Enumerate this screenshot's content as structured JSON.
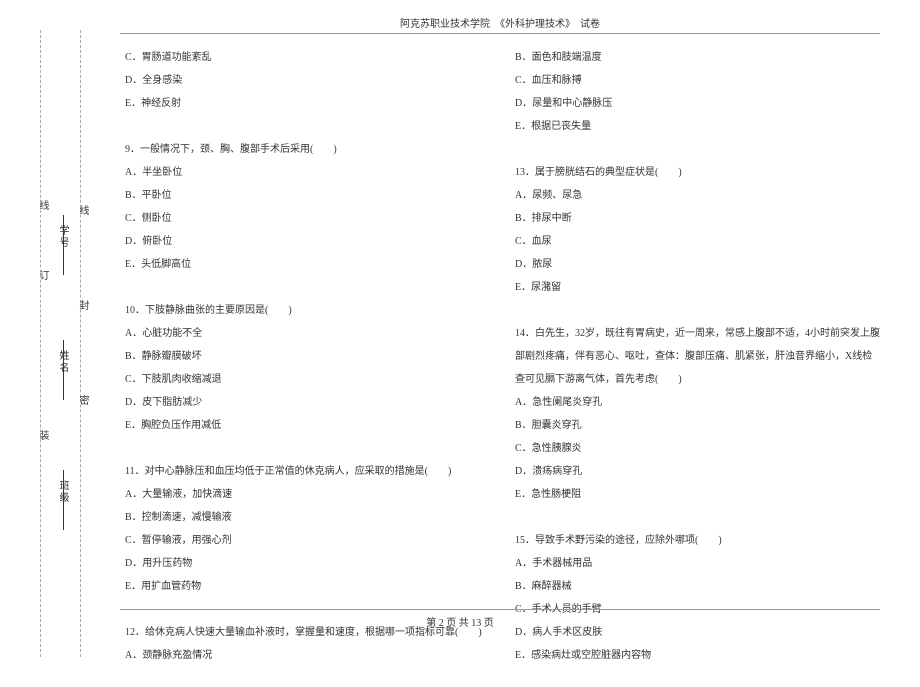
{
  "header": {
    "title": "阿克苏职业技术学院　《外科护理技术》　试卷"
  },
  "binding": {
    "class_label": "班级",
    "name_label": "姓名",
    "id_label": "学号",
    "mi": "密",
    "feng": "封",
    "xian_inner": "线",
    "zhuang": "装",
    "ding": "订",
    "xian_outer": "线"
  },
  "left_column": {
    "items": [
      "C．胃肠道功能紊乱",
      "D．全身感染",
      "E．神经反射",
      "",
      "9．一般情况下，颈、胸、腹部手术后采用(　　)",
      "A．半坐卧位",
      "B．平卧位",
      "C．侧卧位",
      "D．俯卧位",
      "E．头低脚高位",
      "",
      "10．下肢静脉曲张的主要原因是(　　)",
      "A．心脏功能不全",
      "B．静脉瓣膜破坏",
      "C．下肢肌肉收缩减退",
      "D．皮下脂肪减少",
      "E．胸腔负压作用减低",
      "",
      "11．对中心静脉压和血压均低于正常值的休克病人，应采取的措施是(　　)",
      "A．大量输液，加快滴速",
      "B．控制滴速，减慢输液",
      "C．暂停输液，用强心剂",
      "D．用升压药物",
      "E．用扩血管药物",
      "",
      "12．给休克病人快速大量输血补液时，掌握量和速度，根据哪一项指标可靠(　　)",
      "A．颈静脉充盈情况"
    ]
  },
  "right_column": {
    "items": [
      "B．面色和肢端温度",
      "C．血压和脉搏",
      "D．尿量和中心静脉压",
      "E．根据已丧失量",
      "",
      "13．属于膀胱结石的典型症状是(　　)",
      "A．尿频、尿急",
      "B．排尿中断",
      "C．血尿",
      "D．脓尿",
      "E．尿潴留",
      "",
      "14．白先生，32岁，既往有胃病史，近一周来，常感上腹部不适，4小时前突发上腹部剧烈疼痛，伴有恶心、呕吐，查体：腹部压痛、肌紧张，肝浊音界缩小，X线检查可见膈下游离气体，首先考虑(　　)",
      "A．急性阑尾炎穿孔",
      "B．胆囊炎穿孔",
      "C．急性胰腺炎",
      "D．溃疡病穿孔",
      "E．急性肠梗阻",
      "",
      "15．导致手术野污染的途径，应除外哪项(　　)",
      "A．手术器械用品",
      "B．麻醉器械",
      "C．手术人员的手臂",
      "D．病人手术区皮肤",
      "E．感染病灶或空腔脏器内容物"
    ]
  },
  "footer": {
    "text": "第 2 页 共 13 页"
  }
}
